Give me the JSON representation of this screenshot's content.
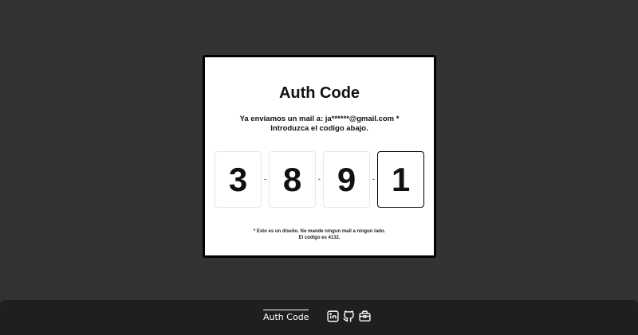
{
  "card": {
    "title": "Auth Code",
    "message_line1": "Ya enviamos un mail a: ja******@gmail.com *",
    "message_line2": "Introduzca el codigo abajo.",
    "digits": [
      "3",
      "8",
      "9",
      "1"
    ],
    "separator": "-",
    "note_line1": "* Esto es un diseño. No mande ningun mail a ningun lado.",
    "note_line2": "El codigo es 4132."
  },
  "footer": {
    "link_label": "Auth Code",
    "icons": [
      "linkedin-icon",
      "github-icon",
      "briefcase-icon"
    ]
  },
  "colors": {
    "background": "#333333",
    "card": "#ffffff",
    "footer": "#1f1f1f",
    "text": "#111111"
  }
}
